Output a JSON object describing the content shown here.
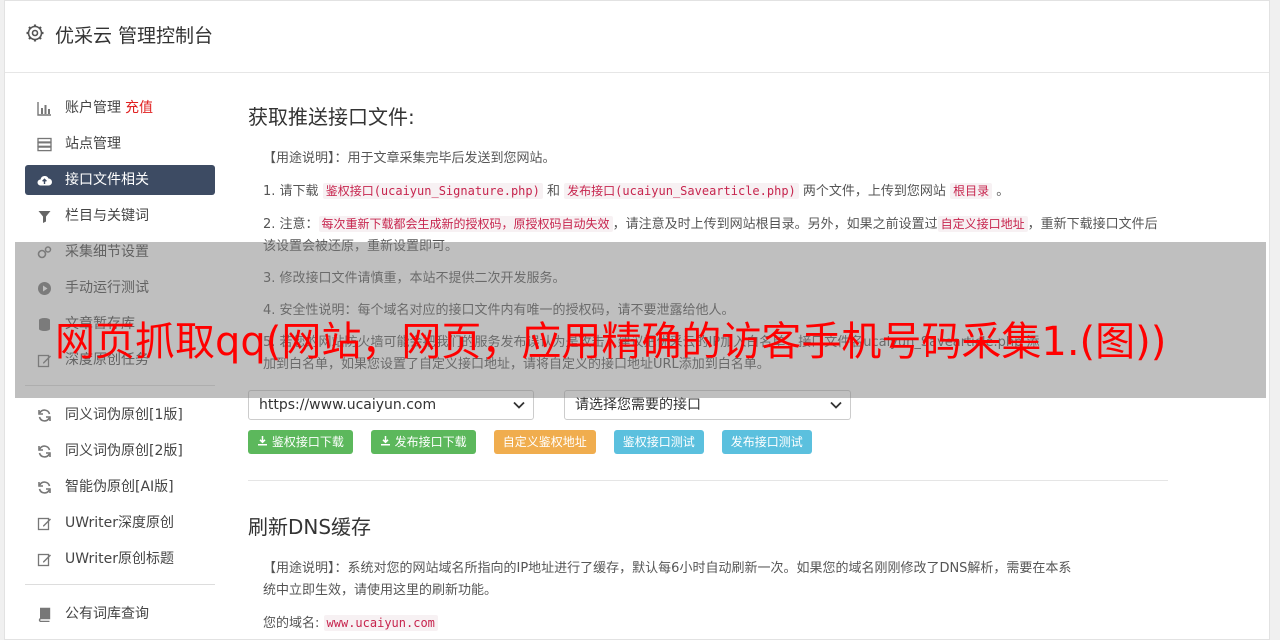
{
  "header": {
    "title": "优采云 管理控制台"
  },
  "sidebar": {
    "items": [
      {
        "label": "账户管理",
        "extra": "充值"
      },
      {
        "label": "站点管理"
      },
      {
        "label": "接口文件相关"
      },
      {
        "label": "栏目与关键词"
      },
      {
        "label": "采集细节设置"
      },
      {
        "label": "手动运行测试"
      },
      {
        "label": "文章暂存库"
      },
      {
        "label": "深度原创任务"
      },
      {
        "label": "同义词伪原创[1版]"
      },
      {
        "label": "同义词伪原创[2版]"
      },
      {
        "label": "智能伪原创[AI版]"
      },
      {
        "label": "UWriter深度原创"
      },
      {
        "label": "UWriter原创标题"
      },
      {
        "label": "公有词库查询"
      }
    ]
  },
  "section1": {
    "title": "获取推送接口文件:",
    "usage": "【用途说明】：用于文章采集完毕后发送到您网站。",
    "p1": {
      "a": "1. 请下载",
      "code1": "鉴权接口(ucaiyun_Signature.php)",
      "b": "和",
      "code2": "发布接口(ucaiyun_Savearticle.php)",
      "c": "两个文件，上传到您网站",
      "code3": "根目录",
      "d": "。"
    },
    "p2": {
      "a": "2. 注意：",
      "code1": "每次重新下载都会生成新的授权码，原授权码自动失效",
      "b": "，请注意及时上传到网站根目录。另外，如果之前设置过",
      "code2": "自定义接口地址",
      "c": "，重新下载接口文件后该设置会被还原，重新设置即可。"
    },
    "p3": "3. 修改接口文件请慎重，本站不提供二次开发服务。",
    "p4": "4. 安全性说明：每个域名对应的接口文件内有唯一的授权码，请不要泄露给他人。",
    "p5a": "5. 若您的网站防火墙可能会把我们的服务发布误认为是攻击，建议把优采云的IP加入白名单，接口文件名ucaiyun_Savearticle.php 添",
    "p5b": "加到白名单，如果您设置了自定义接口地址，请将自定义的接口地址URL添加到白名单。",
    "select_site": "https://www.ucaiyun.com",
    "select_api": "请选择您需要的接口",
    "buttons": {
      "b1": "鉴权接口下载",
      "b2": "发布接口下载",
      "b3": "自定义鉴权地址",
      "b4": "鉴权接口测试",
      "b5": "发布接口测试"
    }
  },
  "section2": {
    "title": "刷新DNS缓存",
    "usage1": "【用途说明】：系统对您的网站域名所指向的IP地址进行了缓存，默认每6小时自动刷新一次。如果您的域名刚刚修改了DNS解析，需要在本系",
    "usage2": "统中立即生效，请使用这里的刷新功能。",
    "domain_label": "您的域名:",
    "domain": "www.ucaiyun.com"
  },
  "overlay": {
    "text": "网页抓取qq(网站，网页，应用精确的访客手机号码采集1.(图))"
  },
  "colors": {
    "sidebar_active": "#3d4b63",
    "btn_green": "#5cb85c",
    "btn_orange": "#f0ad4e",
    "btn_blue": "#5bc0de",
    "overlay_text": "#ff0000"
  }
}
